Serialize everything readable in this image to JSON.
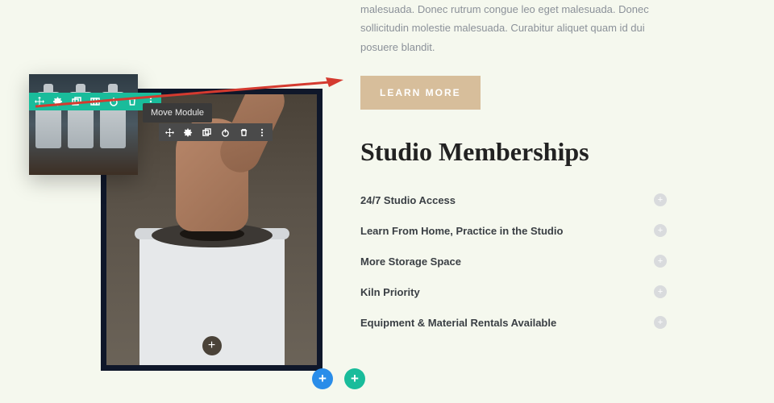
{
  "intro_text": "malesuada. Donec rutrum congue leo eget malesuada. Donec sollicitudin molestie malesuada. Curabitur aliquet quam id dui posuere blandit.",
  "learn_more": "LEARN MORE",
  "heading": "Studio Memberships",
  "accordion": [
    {
      "label": "24/7 Studio Access"
    },
    {
      "label": "Learn From Home, Practice in the Studio"
    },
    {
      "label": "More Storage Space"
    },
    {
      "label": "Kiln Priority"
    },
    {
      "label": "Equipment & Material Rentals Available"
    }
  ],
  "tooltip": "Move Module",
  "teal_toolbar": [
    "move",
    "settings",
    "duplicate",
    "columns",
    "power",
    "delete",
    "more"
  ],
  "dark_toolbar": [
    "move",
    "settings",
    "duplicate",
    "power",
    "delete",
    "more"
  ]
}
